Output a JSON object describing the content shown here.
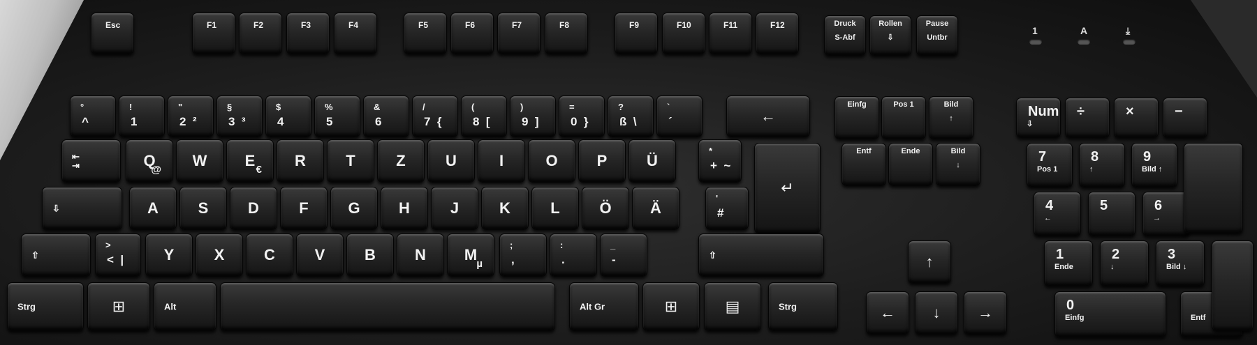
{
  "fkeys": [
    {
      "id": "esc",
      "label": "Esc"
    },
    {
      "id": "f1",
      "label": "F1"
    },
    {
      "id": "f2",
      "label": "F2"
    },
    {
      "id": "f3",
      "label": "F3"
    },
    {
      "id": "f4",
      "label": "F4"
    },
    {
      "id": "f5",
      "label": "F5"
    },
    {
      "id": "f6",
      "label": "F6"
    },
    {
      "id": "f7",
      "label": "F7"
    },
    {
      "id": "f8",
      "label": "F8"
    },
    {
      "id": "f9",
      "label": "F9"
    },
    {
      "id": "f10",
      "label": "F10"
    },
    {
      "id": "f11",
      "label": "F11"
    },
    {
      "id": "f12",
      "label": "F12"
    }
  ],
  "system_keys": [
    {
      "id": "druck",
      "top": "Druck",
      "bottom": "S-Abf"
    },
    {
      "id": "rollen",
      "top": "Rollen",
      "bottom": "⇩"
    },
    {
      "id": "pause",
      "top": "Pause",
      "bottom": "Untbr"
    }
  ],
  "leds": [
    "1",
    "A",
    "⤓"
  ],
  "number_row": [
    {
      "top": "°",
      "bottom": "^"
    },
    {
      "top": "!",
      "bottom": "1"
    },
    {
      "top": "\"",
      "bottom": "2  ²"
    },
    {
      "top": "§",
      "bottom": "3  ³"
    },
    {
      "top": "$",
      "bottom": "4"
    },
    {
      "top": "%",
      "bottom": "5"
    },
    {
      "top": "&",
      "bottom": "6"
    },
    {
      "top": "/",
      "bottom": "7  {"
    },
    {
      "top": "(",
      "bottom": "8  ["
    },
    {
      "top": ")",
      "bottom": "9  ]"
    },
    {
      "top": "=",
      "bottom": "0  }"
    },
    {
      "top": "?",
      "bottom": "ß  \\"
    },
    {
      "top": "`",
      "bottom": "´"
    }
  ],
  "backspace": "←",
  "tab": "⇤\n⇥",
  "qwertz_row": [
    "Q",
    "W",
    "E",
    "R",
    "T",
    "Z",
    "U",
    "I",
    "O",
    "P",
    "Ü"
  ],
  "qwertz_alt": {
    "Q": "@",
    "E": "€"
  },
  "plus_key": {
    "top": "*",
    "bottom": "+  ~"
  },
  "enter": "↵",
  "caps": "⇩",
  "home_row": [
    "A",
    "S",
    "D",
    "F",
    "G",
    "H",
    "J",
    "K",
    "L",
    "Ö",
    "Ä"
  ],
  "hash_key": {
    "top": "'",
    "bottom": "#"
  },
  "shift": "⇧",
  "angle_key": {
    "top": ">",
    "bottom": "<  |"
  },
  "bottom_letters": [
    "Y",
    "X",
    "C",
    "V",
    "B",
    "N",
    "M"
  ],
  "m_alt": "µ",
  "punct_keys": [
    {
      "top": ";",
      "bottom": ","
    },
    {
      "top": ":",
      "bottom": "."
    },
    {
      "top": "_",
      "bottom": "-"
    }
  ],
  "ctrl_left": "Strg",
  "win": "⊞",
  "alt": "Alt",
  "altgr": "Alt Gr",
  "menu": "▤",
  "ctrl_right": "Strg",
  "nav_keys": [
    {
      "id": "einfg",
      "top": "Einfg",
      "bottom": ""
    },
    {
      "id": "pos1",
      "top": "Pos 1",
      "bottom": ""
    },
    {
      "id": "bild-up",
      "top": "Bild",
      "bottom": "↑"
    },
    {
      "id": "entf",
      "top": "Entf",
      "bottom": ""
    },
    {
      "id": "ende",
      "top": "Ende",
      "bottom": ""
    },
    {
      "id": "bild-down",
      "top": "Bild",
      "bottom": "↓"
    }
  ],
  "arrows": {
    "up": "↑",
    "left": "←",
    "down": "↓",
    "right": "→"
  },
  "numpad": [
    {
      "id": "num",
      "top": "Num",
      "bottom": "⇩"
    },
    {
      "id": "div",
      "top": "÷",
      "bottom": ""
    },
    {
      "id": "mul",
      "top": "×",
      "bottom": ""
    },
    {
      "id": "minus",
      "top": "−",
      "bottom": ""
    },
    {
      "id": "n7",
      "top": "7",
      "bottom": "Pos 1"
    },
    {
      "id": "n8",
      "top": "8",
      "bottom": "↑"
    },
    {
      "id": "n9",
      "top": "9",
      "bottom": "Bild ↑"
    },
    {
      "id": "n4",
      "top": "4",
      "bottom": "←"
    },
    {
      "id": "n5",
      "top": "5",
      "bottom": ""
    },
    {
      "id": "n6",
      "top": "6",
      "bottom": "→"
    },
    {
      "id": "n1",
      "top": "1",
      "bottom": "Ende"
    },
    {
      "id": "n2",
      "top": "2",
      "bottom": "↓"
    },
    {
      "id": "n3",
      "top": "3",
      "bottom": "Bild ↓"
    },
    {
      "id": "n0",
      "top": "0",
      "bottom": "Einfg"
    },
    {
      "id": "ndel",
      "top": "",
      "bottom": "Entf"
    }
  ]
}
